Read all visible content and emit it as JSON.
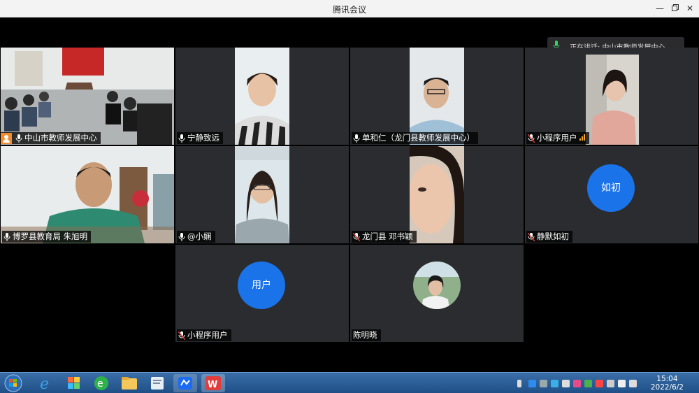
{
  "window": {
    "title": "腾讯会议"
  },
  "speaking": {
    "text": "正在讲话: 中山市教师发展中心..."
  },
  "participants": [
    {
      "name": "中山市教师发展中心",
      "host": true
    },
    {
      "name": "宁静致远"
    },
    {
      "name": "单和仁（龙门县教师发展中心）"
    },
    {
      "name": "小程序用户"
    },
    {
      "name": "博罗县教育局  朱旭明"
    },
    {
      "name": "@小娴"
    },
    {
      "name": "龙门县 邓书颖"
    },
    {
      "name": "静默如初",
      "avatar_text": "如初"
    },
    {
      "name": "小程序用户",
      "avatar_text": "用户"
    },
    {
      "name": "陈明晓"
    }
  ],
  "taskbar": {
    "clock_time": "15:04",
    "clock_date": "2022/6/2"
  },
  "colors": {
    "accent": "#1a73e8",
    "tile_bg": "#2b2c2f",
    "active_border": "#2fae5e"
  }
}
